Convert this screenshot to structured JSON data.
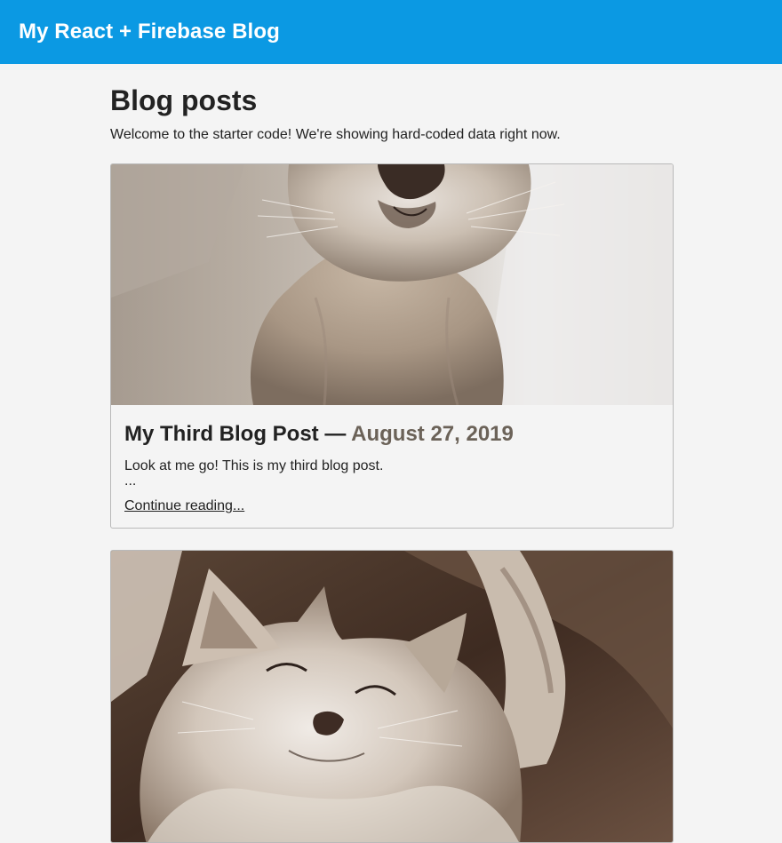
{
  "header": {
    "title": "My React + Firebase Blog"
  },
  "page": {
    "title": "Blog posts",
    "intro": "Welcome to the starter code! We're showing hard-coded data right now."
  },
  "posts": [
    {
      "title": "My Third Blog Post",
      "separator": " — ",
      "date": "August 27, 2019",
      "excerpt": "Look at me go! This is my third blog post.",
      "ellipsis": "...",
      "link_label": "Continue reading...",
      "image": "kitten-photo"
    },
    {
      "image": "sleeping-kitten-photo"
    }
  ],
  "colors": {
    "header_bg": "#0b99e3",
    "page_bg": "#f4f4f4",
    "date_text": "#6b6258"
  }
}
